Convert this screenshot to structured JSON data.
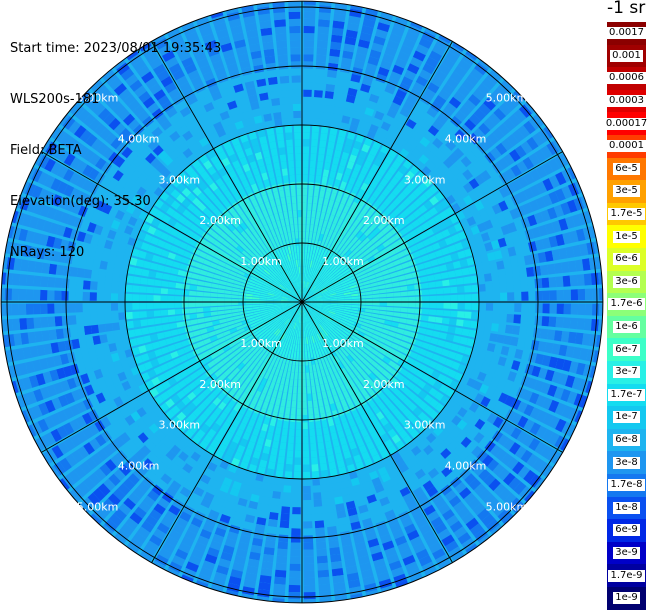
{
  "info": {
    "start_time": "Start time: 2023/08/01 19:35:43",
    "instrument": "WLS200s-181",
    "field": "Field: BETA",
    "elevation": "Elevation(deg): 35.30",
    "nrays": "NRays: 120"
  },
  "colorbar": {
    "unit_label": "-1 sr",
    "levels": [
      {
        "label": "0.0017",
        "color": "#8b0000"
      },
      {
        "label": "0.001",
        "color": "#a00000"
      },
      {
        "label": "0.0006",
        "color": "#c00000"
      },
      {
        "label": "0.0003",
        "color": "#e00000"
      },
      {
        "label": "0.00017",
        "color": "#ff0000"
      },
      {
        "label": "0.0001",
        "color": "#ff3c00"
      },
      {
        "label": "6e-5",
        "color": "#ff7800"
      },
      {
        "label": "3e-5",
        "color": "#ffa000"
      },
      {
        "label": "1.7e-5",
        "color": "#ffc800"
      },
      {
        "label": "1e-5",
        "color": "#ffff00"
      },
      {
        "label": "6e-6",
        "color": "#dcff28"
      },
      {
        "label": "3e-6",
        "color": "#b4ff50"
      },
      {
        "label": "1.7e-6",
        "color": "#8cff78"
      },
      {
        "label": "1e-6",
        "color": "#64ffa0"
      },
      {
        "label": "6e-7",
        "color": "#3cffc8"
      },
      {
        "label": "3e-7",
        "color": "#28f0e6"
      },
      {
        "label": "1.7e-7",
        "color": "#14dcf0"
      },
      {
        "label": "1e-7",
        "color": "#14c8f0"
      },
      {
        "label": "6e-8",
        "color": "#1eb4f0"
      },
      {
        "label": "3e-8",
        "color": "#1e96f0"
      },
      {
        "label": "1.7e-8",
        "color": "#1478f0"
      },
      {
        "label": "1e-8",
        "color": "#0a50f0"
      },
      {
        "label": "6e-9",
        "color": "#0028e6"
      },
      {
        "label": "3e-9",
        "color": "#0000c8"
      },
      {
        "label": "1.7e-9",
        "color": "#0000a0"
      },
      {
        "label": "1e-9",
        "color": "#000070"
      }
    ]
  },
  "chart_data": {
    "type": "heatmap",
    "projection": "polar (PPI scan)",
    "field": "BETA",
    "rays": 120,
    "range_rings_km": [
      1,
      2,
      3,
      4,
      5
    ],
    "range_ring_labels": [
      "1.00km",
      "2.00km",
      "3.00km",
      "4.00km",
      "5.00km"
    ],
    "max_range_km": 5.1,
    "spoke_angles_deg": [
      0,
      30,
      60,
      90,
      120,
      150,
      180,
      210,
      240,
      270,
      300,
      330
    ],
    "value_bands_by_range": [
      {
        "range_km": [
          0.0,
          1.0
        ],
        "typical": "3e-7",
        "color": "#28f0e6"
      },
      {
        "range_km": [
          1.0,
          2.0
        ],
        "typical": "3e-7",
        "color": "#30ecdf"
      },
      {
        "range_km": [
          2.0,
          3.0
        ],
        "typical": "1.7e-7",
        "color": "#14dcf0"
      },
      {
        "range_km": [
          3.0,
          4.0
        ],
        "typical": "6e-8",
        "color": "#1eb4f0"
      },
      {
        "range_km": [
          4.0,
          5.1
        ],
        "typical": "3e-8",
        "color": "#1e96f0"
      }
    ]
  }
}
